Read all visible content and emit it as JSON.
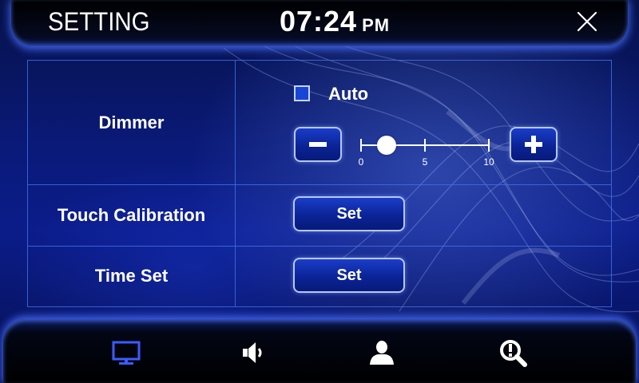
{
  "header": {
    "title": "SETTING",
    "time": "07:24",
    "ampm": "PM",
    "close_icon": "close-icon"
  },
  "settings": {
    "dimmer": {
      "label": "Dimmer",
      "auto_label": "Auto",
      "auto_checked": false,
      "decrease_icon": "minus-icon",
      "increase_icon": "plus-icon",
      "slider": {
        "min": 0,
        "max": 10,
        "value": 2,
        "tick_labels": [
          "0",
          "5",
          "10"
        ]
      }
    },
    "touch_calibration": {
      "label": "Touch Calibration",
      "button_label": "Set"
    },
    "time_set": {
      "label": "Time Set",
      "button_label": "Set"
    }
  },
  "bottom_nav": {
    "items": [
      {
        "icon": "display-icon",
        "active": true
      },
      {
        "icon": "speaker-icon",
        "active": false
      },
      {
        "icon": "user-icon",
        "active": false
      },
      {
        "icon": "info-search-icon",
        "active": false
      }
    ],
    "active_color": "#3a5cff",
    "inactive_color": "#ffffff"
  }
}
